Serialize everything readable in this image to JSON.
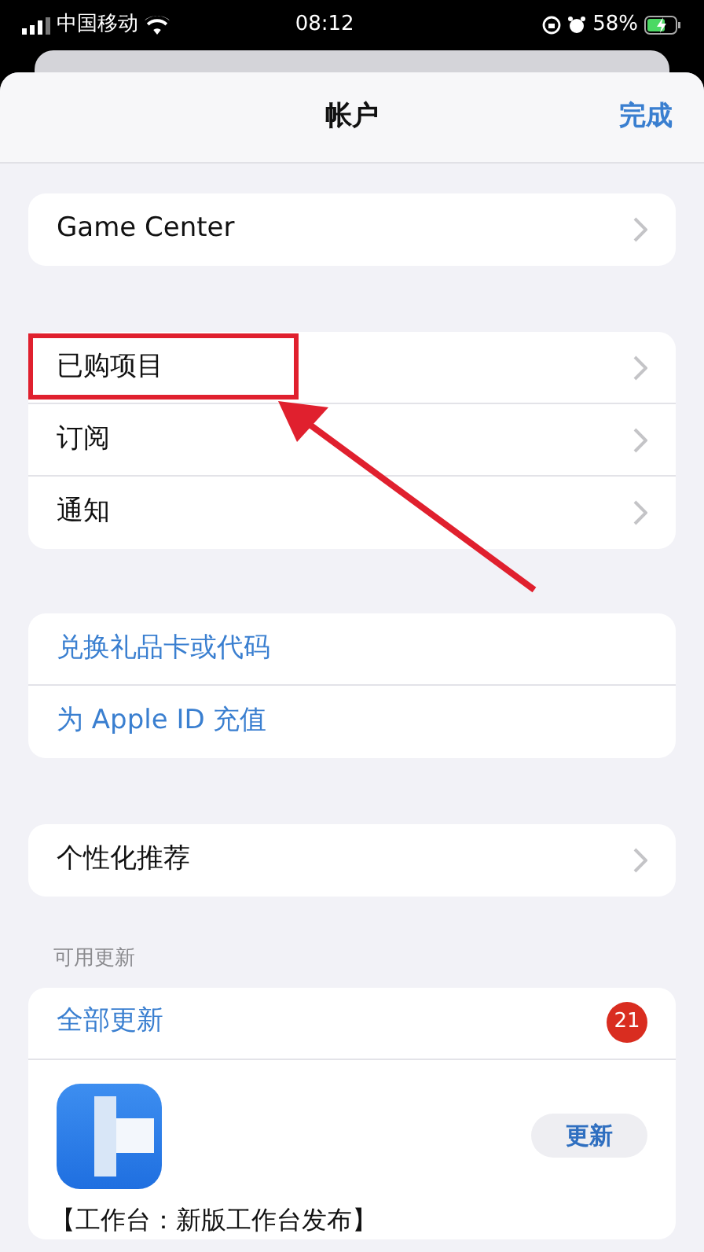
{
  "status_bar": {
    "carrier": "中国移动",
    "time": "08:12",
    "battery": "58%"
  },
  "header": {
    "title": "帐户",
    "done": "完成"
  },
  "groups": [
    {
      "rows": [
        {
          "label": "Game Center",
          "kind": "nav",
          "highlighted": false
        }
      ]
    },
    {
      "rows": [
        {
          "label": "已购项目",
          "kind": "nav",
          "highlighted": true
        },
        {
          "label": "订阅",
          "kind": "nav",
          "highlighted": false
        },
        {
          "label": "通知",
          "kind": "nav",
          "highlighted": false
        }
      ]
    },
    {
      "rows": [
        {
          "label": "兑换礼品卡或代码",
          "kind": "link",
          "highlighted": false
        },
        {
          "label": "为 Apple ID 充值",
          "kind": "link",
          "highlighted": false
        }
      ]
    },
    {
      "rows": [
        {
          "label": "个性化推荐",
          "kind": "nav",
          "highlighted": false
        }
      ]
    }
  ],
  "updates": {
    "header": "可用更新",
    "update_all": "全部更新",
    "badge": "21",
    "apps": [
      {
        "button": "更新",
        "notes": "【工作台：新版工作台发布】"
      }
    ]
  }
}
